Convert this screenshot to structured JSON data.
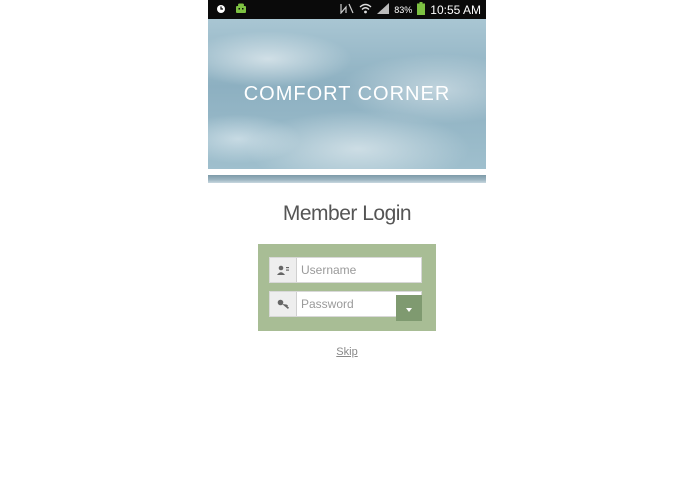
{
  "status_bar": {
    "battery_percent": "83%",
    "time": "10:55 AM",
    "icons": [
      "alarm-icon",
      "android-icon",
      "nfc-icon",
      "wifi-icon",
      "signal-icon",
      "battery-icon"
    ]
  },
  "hero": {
    "title": "COMFORT CORNER"
  },
  "login": {
    "title": "Member Login",
    "username": {
      "placeholder": "Username",
      "value": "",
      "icon": "user-icon"
    },
    "password": {
      "placeholder": "Password",
      "value": "",
      "icon": "key-icon"
    },
    "submit_icon": "arrow-down-icon",
    "skip_label": "Skip"
  },
  "colors": {
    "form_background": "#a8bd95",
    "submit_button": "#7f9a70",
    "status_bar": "#0a0a0a"
  }
}
